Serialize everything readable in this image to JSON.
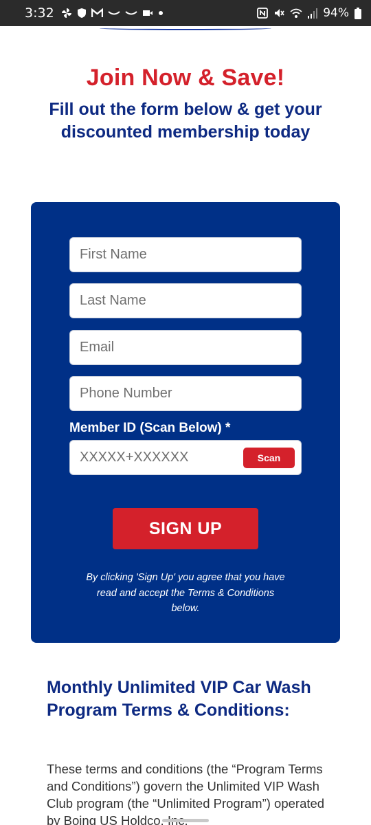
{
  "status_bar": {
    "time": "3:32",
    "battery": "94%",
    "left_icons": [
      "pinwheel-icon",
      "shield-icon",
      "gmail-icon",
      "wave-icon",
      "wave-icon",
      "video-icon",
      "dot-icon"
    ],
    "right_icons": [
      "nfc-icon",
      "mute-icon",
      "wifi-icon",
      "signal-icon",
      "battery-icon"
    ]
  },
  "hero": {
    "headline": "Join Now & Save!",
    "subhead": "Fill out the form below & get your discounted membership today"
  },
  "form": {
    "first_name_placeholder": "First Name",
    "last_name_placeholder": "Last Name",
    "email_placeholder": "Email",
    "phone_placeholder": "Phone Number",
    "member_id_label": "Member ID (Scan Below) *",
    "member_id_placeholder": "XXXXX+XXXXXX",
    "scan_label": "Scan",
    "signup_label": "SIGN UP",
    "agree_text": "By clicking 'Sign Up' you agree that you have read and accept the Terms & Conditions below."
  },
  "terms": {
    "title": "Monthly Unlimited VIP Car Wash Program Terms & Conditions:",
    "body": "These terms and conditions (the “Program Terms and Conditions”) govern the Unlimited VIP Wash Club program (the “Unlimited Program”) operated by Boing US Holdco, Inc."
  },
  "colors": {
    "accent_red": "#d4212b",
    "brand_blue": "#003087",
    "heading_blue": "#0e2a82"
  }
}
